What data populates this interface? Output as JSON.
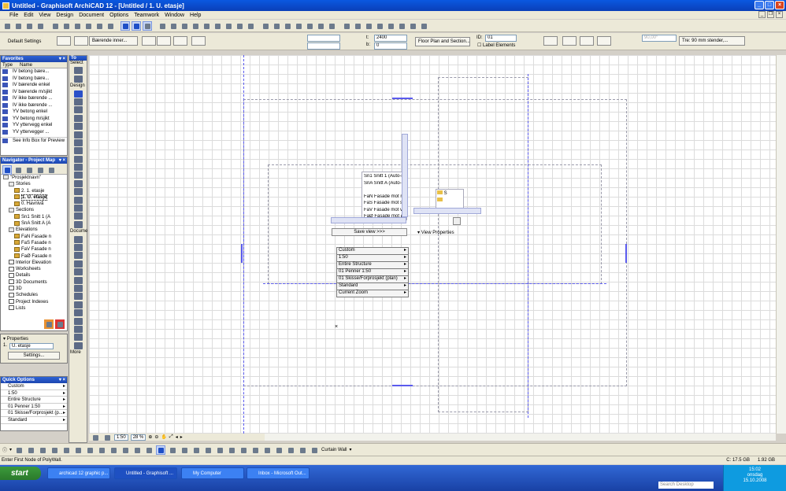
{
  "window": {
    "title": "Untitled - Graphisoft ArchiCAD 12 - [Untitled / 1. U. etasje]"
  },
  "menu": [
    "File",
    "Edit",
    "View",
    "Design",
    "Document",
    "Options",
    "Teamwork",
    "Window",
    "Help"
  ],
  "infobox": {
    "default_settings": "Default Settings",
    "layer": "Bærende inner...",
    "field_1": "2400",
    "field_2": "0",
    "field_t": "t:",
    "field_b": "b:",
    "floor_plan_btn": "Floor Plan and Section...",
    "id_label": "ID:",
    "id_value": "01",
    "label_elements": "Label Elements",
    "angle": "90,00°",
    "composite": "Tre: 90 mm stender,..."
  },
  "favorites": {
    "title": "Favorites",
    "col_type": "Type",
    "col_name": "Name",
    "items": [
      "IV betong bære...",
      "IV betong bære...",
      "IV bærende enkel",
      "IV bærende m/sjikt",
      "IV ikke bærende ...",
      "IV ikke bærende ...",
      "YV betong enkel",
      "YV betong m/sjikt",
      "YV yttervegg enkel",
      "YV yttervegger ..."
    ],
    "preview_label": "See Info Box for Preview"
  },
  "toolbox": {
    "header": "To",
    "select": "Select",
    "design": "Design",
    "document": "Docume",
    "more": "More"
  },
  "navigator": {
    "title": "Navigator - Project Map",
    "tree": [
      {
        "label": "\"Prosjektnavn\"",
        "indent": 0,
        "icon": "gray"
      },
      {
        "label": "Stories",
        "indent": 1,
        "icon": "gray"
      },
      {
        "label": "2. 1. etasje",
        "indent": 2,
        "icon": "folder"
      },
      {
        "label": "1. U. etasje",
        "indent": 2,
        "icon": "folder",
        "selected": true
      },
      {
        "label": "0. Havnivå",
        "indent": 2,
        "icon": "folder"
      },
      {
        "label": "Sections",
        "indent": 1,
        "icon": "gray"
      },
      {
        "label": "Sn1 Snitt 1 (A",
        "indent": 2,
        "icon": "folder"
      },
      {
        "label": "SnA Snitt A (A",
        "indent": 2,
        "icon": "folder"
      },
      {
        "label": "Elevations",
        "indent": 1,
        "icon": "gray"
      },
      {
        "label": "FaN Fasade n",
        "indent": 2,
        "icon": "folder"
      },
      {
        "label": "FaS Fasade n",
        "indent": 2,
        "icon": "folder"
      },
      {
        "label": "FaV Fasade n",
        "indent": 2,
        "icon": "folder"
      },
      {
        "label": "FaØ Fasade n",
        "indent": 2,
        "icon": "folder"
      },
      {
        "label": "Interior Elevation",
        "indent": 1,
        "icon": "doc"
      },
      {
        "label": "Worksheets",
        "indent": 1,
        "icon": "doc"
      },
      {
        "label": "Details",
        "indent": 1,
        "icon": "doc"
      },
      {
        "label": "3D Documents",
        "indent": 1,
        "icon": "doc"
      },
      {
        "label": "3D",
        "indent": 1,
        "icon": "doc"
      },
      {
        "label": "Schedules",
        "indent": 1,
        "icon": "doc"
      },
      {
        "label": "Project Indexes",
        "indent": 1,
        "icon": "doc"
      },
      {
        "label": "Lists",
        "indent": 1,
        "icon": "doc"
      }
    ]
  },
  "properties": {
    "title": "Properties",
    "story_num": "1.",
    "story_name": "U. etasje",
    "settings_btn": "Settings..."
  },
  "quick_options": {
    "title": "Quick Options",
    "items": [
      "Custom",
      "1:50",
      "Entire Structure",
      "01 Penner 1:50",
      "01 Skisse/Forprosjekt (p...",
      "Standard"
    ]
  },
  "canvas_popup": {
    "view_list": [
      "Sn1 Snitt 1 (Auto-r",
      "SnA Snitt A (Auto-r",
      "",
      "FaN Fasade mot no",
      "FaS Fasade mot sø",
      "FaV Fasade mot ve",
      "FaØ Fasade mot ø"
    ],
    "save_view": "Save view >>>",
    "view_properties": "View Properties",
    "options": [
      "Custom",
      "1:50",
      "Entire Structure",
      "01 Penner 1:50",
      "01 Skisse/Forprosjekt (plan)",
      "Standard",
      "Current Zoom"
    ]
  },
  "bottom_controls": {
    "scale": "1:50",
    "zoom": "28 %"
  },
  "bottom_toolbar": {
    "curtain_wall": "Curtain Wall"
  },
  "status": {
    "message": "Enter First Node of PolyWall.",
    "disk": "C: 17.5 GB",
    "memory": "1.92 GB"
  },
  "taskbar": {
    "start": "start",
    "tasks": [
      "archicad 12 graphic p...",
      "Untitled - Graphisoft ...",
      "My Computer",
      "Inbox - Microsoft Out..."
    ],
    "search_placeholder": "Search Desktop",
    "time": "15:02",
    "day": "onsdag",
    "date": "15.10.2008"
  }
}
